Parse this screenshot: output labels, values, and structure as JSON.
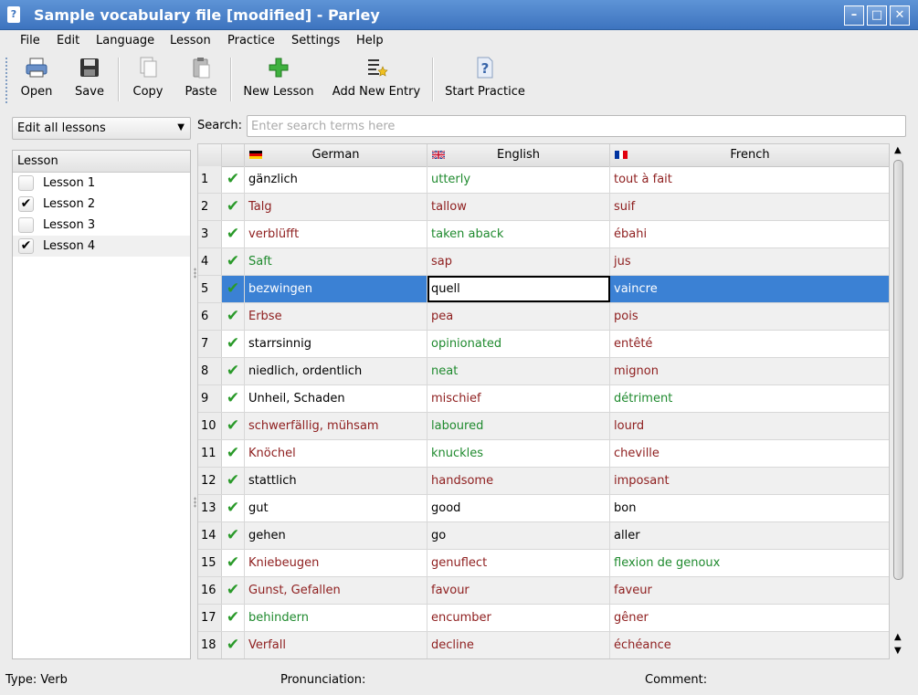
{
  "window": {
    "title": "Sample vocabulary file [modified] - Parley"
  },
  "menu": [
    "File",
    "Edit",
    "Language",
    "Lesson",
    "Practice",
    "Settings",
    "Help"
  ],
  "toolbar": {
    "open": "Open",
    "save": "Save",
    "copy": "Copy",
    "paste": "Paste",
    "new_lesson": "New Lesson",
    "add_entry": "Add New Entry",
    "start_practice": "Start Practice"
  },
  "lesson_filter": {
    "selected": "Edit all lessons"
  },
  "lessons": {
    "header": "Lesson",
    "items": [
      {
        "label": "Lesson 1",
        "checked": false
      },
      {
        "label": "Lesson 2",
        "checked": true
      },
      {
        "label": "Lesson 3",
        "checked": false
      },
      {
        "label": "Lesson 4",
        "checked": true
      }
    ]
  },
  "search": {
    "label": "Search:",
    "placeholder": "Enter search terms here",
    "value": ""
  },
  "columns": {
    "german": "German",
    "english": "English",
    "french": "French"
  },
  "rows": [
    {
      "n": "1",
      "de": "gänzlich",
      "en": "utterly",
      "fr": "tout à fait",
      "dc": "b",
      "ec": "g",
      "fc": "r"
    },
    {
      "n": "2",
      "de": "Talg",
      "en": "tallow",
      "fr": "suif",
      "dc": "r",
      "ec": "r",
      "fc": "r"
    },
    {
      "n": "3",
      "de": "verblüfft",
      "en": "taken aback",
      "fr": "ébahi",
      "dc": "r",
      "ec": "g",
      "fc": "r"
    },
    {
      "n": "4",
      "de": "Saft",
      "en": "sap",
      "fr": "jus",
      "dc": "g",
      "ec": "r",
      "fc": "r"
    },
    {
      "n": "5",
      "de": "bezwingen",
      "en": "quell",
      "fr": "vaincre",
      "dc": "b",
      "ec": "b",
      "fc": "b"
    },
    {
      "n": "6",
      "de": "Erbse",
      "en": "pea",
      "fr": "pois",
      "dc": "r",
      "ec": "r",
      "fc": "r"
    },
    {
      "n": "7",
      "de": "starrsinnig",
      "en": "opinionated",
      "fr": "entêté",
      "dc": "b",
      "ec": "g",
      "fc": "r"
    },
    {
      "n": "8",
      "de": "niedlich, ordentlich",
      "en": "neat",
      "fr": "mignon",
      "dc": "b",
      "ec": "g",
      "fc": "r"
    },
    {
      "n": "9",
      "de": "Unheil, Schaden",
      "en": "mischief",
      "fr": "détriment",
      "dc": "b",
      "ec": "r",
      "fc": "g"
    },
    {
      "n": "10",
      "de": "schwerfällig, mühsam",
      "en": "laboured",
      "fr": "lourd",
      "dc": "r",
      "ec": "g",
      "fc": "r"
    },
    {
      "n": "11",
      "de": "Knöchel",
      "en": "knuckles",
      "fr": "cheville",
      "dc": "r",
      "ec": "g",
      "fc": "r"
    },
    {
      "n": "12",
      "de": "stattlich",
      "en": "handsome",
      "fr": "imposant",
      "dc": "b",
      "ec": "r",
      "fc": "r"
    },
    {
      "n": "13",
      "de": "gut",
      "en": "good",
      "fr": "bon",
      "dc": "b",
      "ec": "b",
      "fc": "b"
    },
    {
      "n": "14",
      "de": "gehen",
      "en": "go",
      "fr": "aller",
      "dc": "b",
      "ec": "b",
      "fc": "b"
    },
    {
      "n": "15",
      "de": "Kniebeugen",
      "en": "genuflect",
      "fr": "flexion de genoux",
      "dc": "r",
      "ec": "r",
      "fc": "g"
    },
    {
      "n": "16",
      "de": "Gunst, Gefallen",
      "en": "favour",
      "fr": "faveur",
      "dc": "r",
      "ec": "r",
      "fc": "r"
    },
    {
      "n": "17",
      "de": "behindern",
      "en": "encumber",
      "fr": "gêner",
      "dc": "g",
      "ec": "r",
      "fc": "r"
    },
    {
      "n": "18",
      "de": "Verfall",
      "en": "decline",
      "fr": "échéance",
      "dc": "r",
      "ec": "r",
      "fc": "r"
    }
  ],
  "selected_row": 4,
  "status": {
    "type": "Type: Verb",
    "pronunciation": "Pronunciation:",
    "comment": "Comment:"
  },
  "colors": {
    "known": "#1f8a2e",
    "unknown": "#8f2020",
    "selection": "#3b81d4",
    "titlebar": "#3d74bf"
  }
}
